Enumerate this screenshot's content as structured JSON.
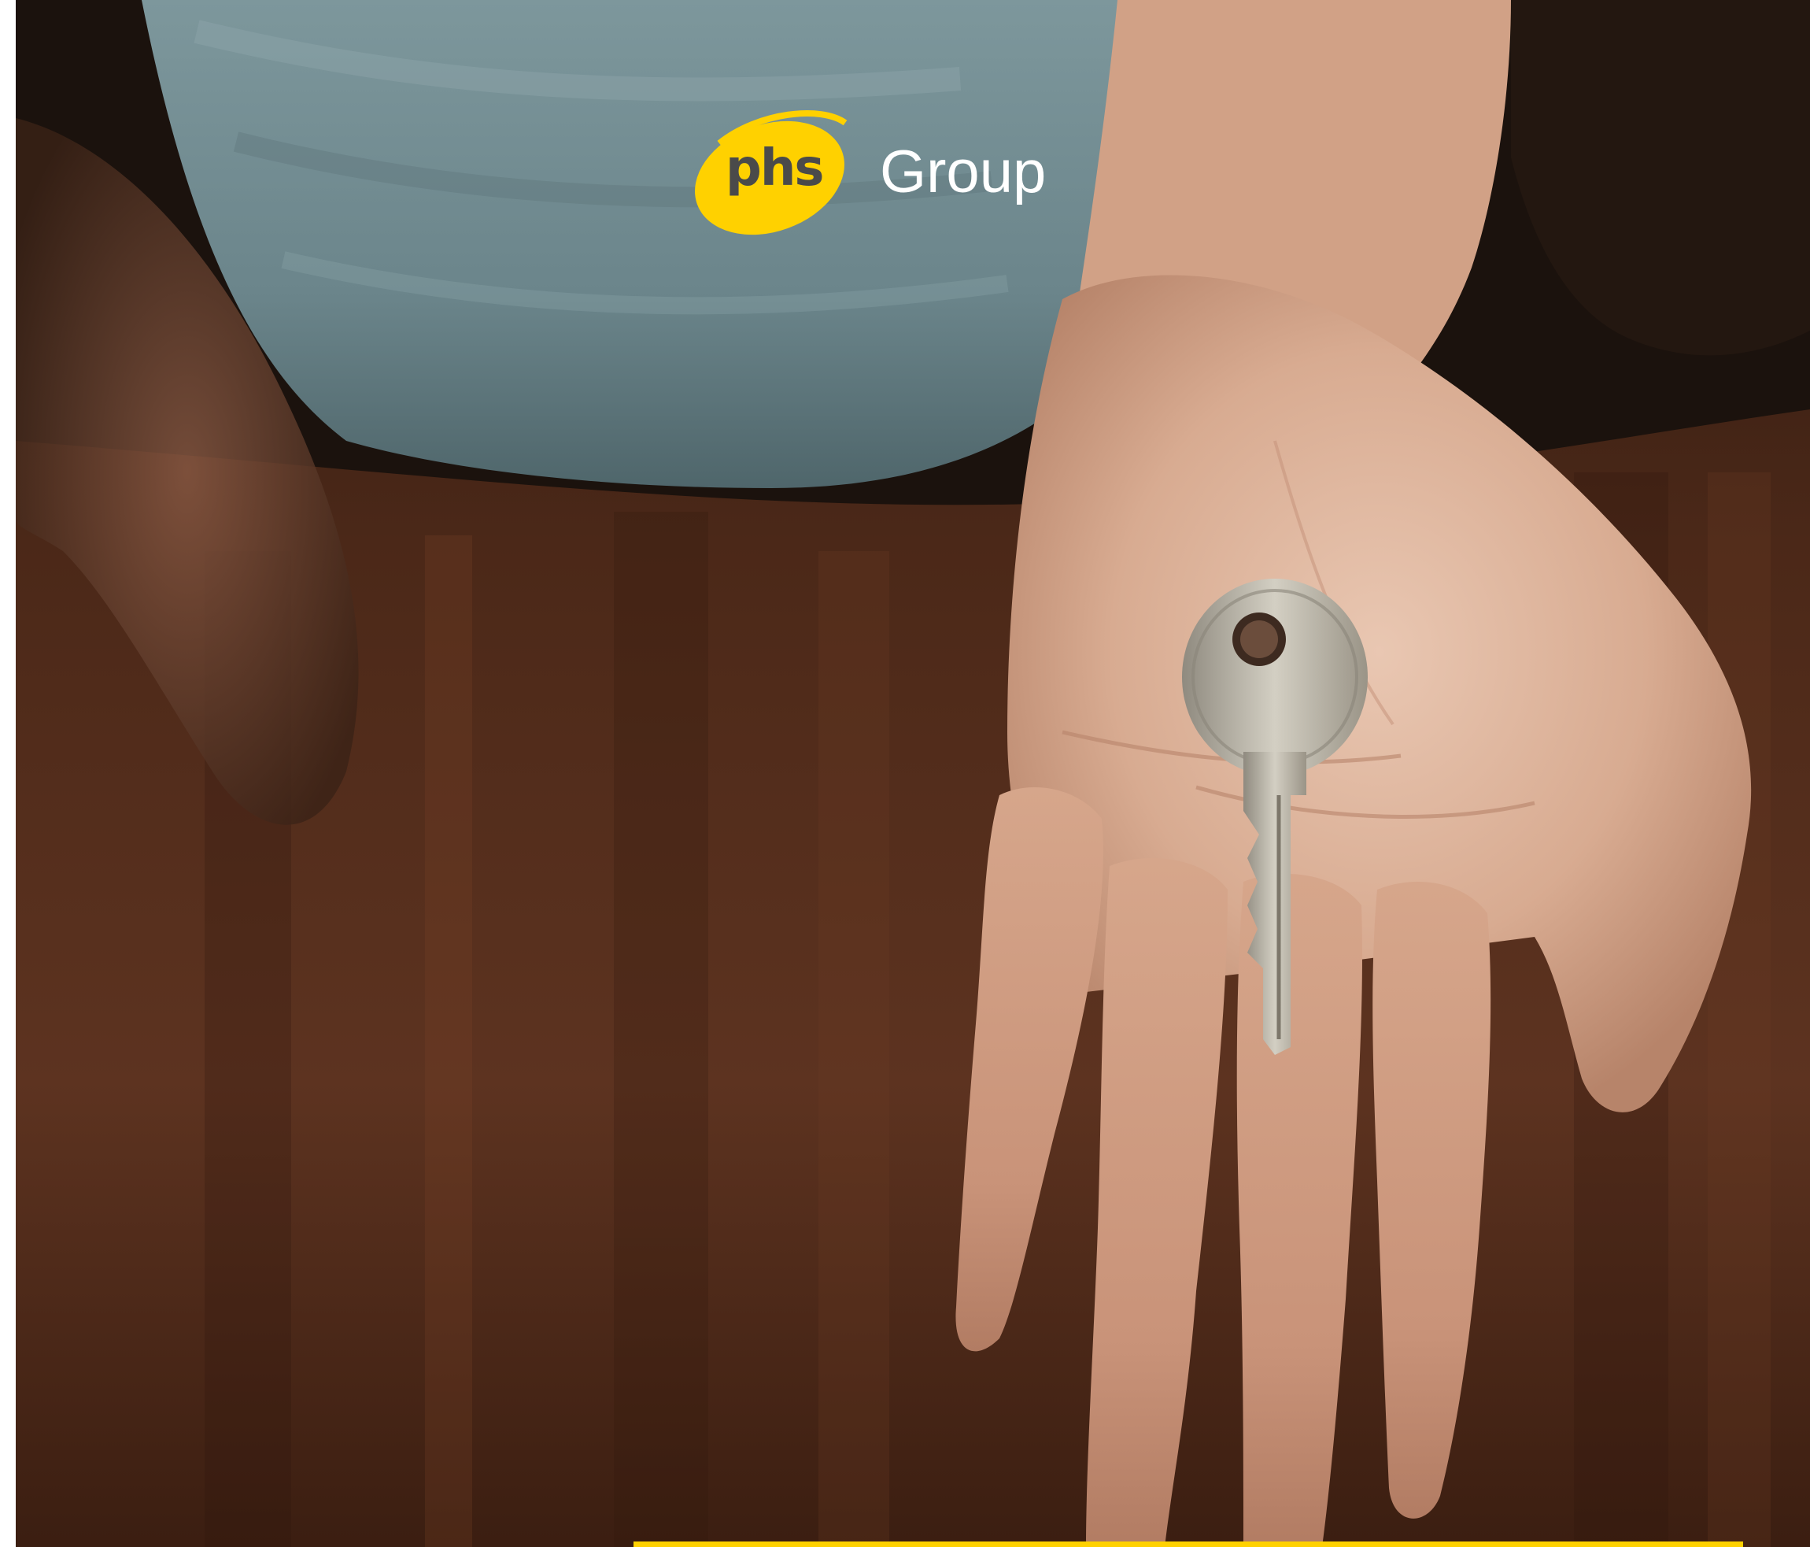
{
  "brand": {
    "mark_text": "phs",
    "name_text": "Group",
    "accent_color": "#FFD100",
    "mark_text_color": "#4a4a4a",
    "name_text_color": "#ffffff"
  },
  "photo": {
    "subject": "open-hand-holding-key",
    "colors": {
      "shirt": "#6f8a90",
      "skin": "#d7ad93",
      "floor": "#4a2716",
      "key": "#bdb7a8"
    }
  },
  "accent_strip": {
    "color": "#FFD100"
  }
}
